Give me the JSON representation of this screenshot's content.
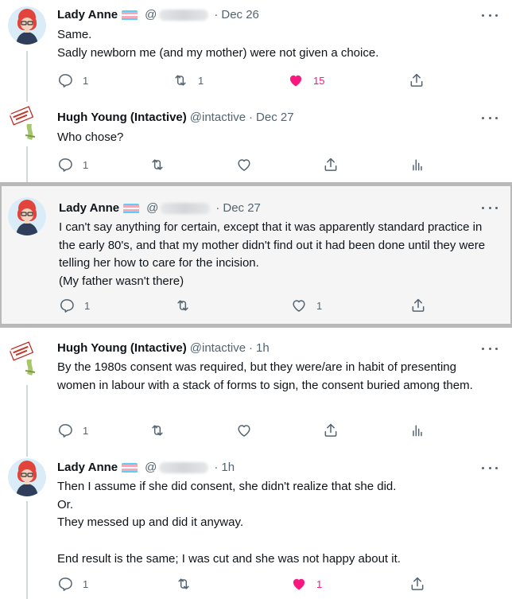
{
  "tweets": [
    {
      "author": "Lady Anne",
      "handle": "@",
      "time": "Dec 26",
      "text": "Same.\nSadly newborn me (and my mother) were not given a choice.",
      "reply_count": "1",
      "retweet_count": "1",
      "like_count": "15",
      "liked": true
    },
    {
      "author": "Hugh Young (Intactive)",
      "handle": "@intactive",
      "time": "Dec 27",
      "text": "Who chose?",
      "reply_count": "1",
      "retweet_count": "",
      "like_count": "",
      "liked": false
    },
    {
      "author": "Lady Anne",
      "handle": "@",
      "time": "Dec 27",
      "text": "I can't say anything for certain, except that it was apparently standard practice in the early 80's, and that my mother didn't find out it had been done until they were telling her how to care for the incision.\n(My father wasn't there)",
      "reply_count": "1",
      "retweet_count": "",
      "like_count": "1",
      "liked": false
    },
    {
      "author": "Hugh Young (Intactive)",
      "handle": "@intactive",
      "time": "1h",
      "text": "By the 1980s consent was required, but they were/are in habit of presenting women in labour with a stack of forms to sign, the consent buried among them.",
      "reply_count": "1",
      "retweet_count": "",
      "like_count": "",
      "liked": false
    },
    {
      "author": "Lady Anne",
      "handle": "@",
      "time": "1h",
      "text": "Then I assume if she did consent, she didn't realize that she did.\nOr.\nThey messed up and did it anyway.\n\nEnd result is the same; I was cut and she was not happy about it.",
      "reply_count": "1",
      "retweet_count": "",
      "like_count": "1",
      "liked": true
    }
  ],
  "separator": "·",
  "colors": {
    "like_active": "#f91880",
    "text_secondary": "#536471",
    "thread_line": "#cfd9de",
    "highlight_bg": "#f5f5f5",
    "highlight_border": "#b9b9b9",
    "trans_flag": [
      "#5bcefa",
      "#f5a9b8",
      "#ffffff",
      "#f5a9b8",
      "#5bcefa"
    ]
  },
  "icons": {
    "reply": "reply-icon",
    "retweet": "retweet-icon",
    "like": "heart-icon",
    "share": "share-icon",
    "analytics": "analytics-icon",
    "more": "more-icon"
  }
}
